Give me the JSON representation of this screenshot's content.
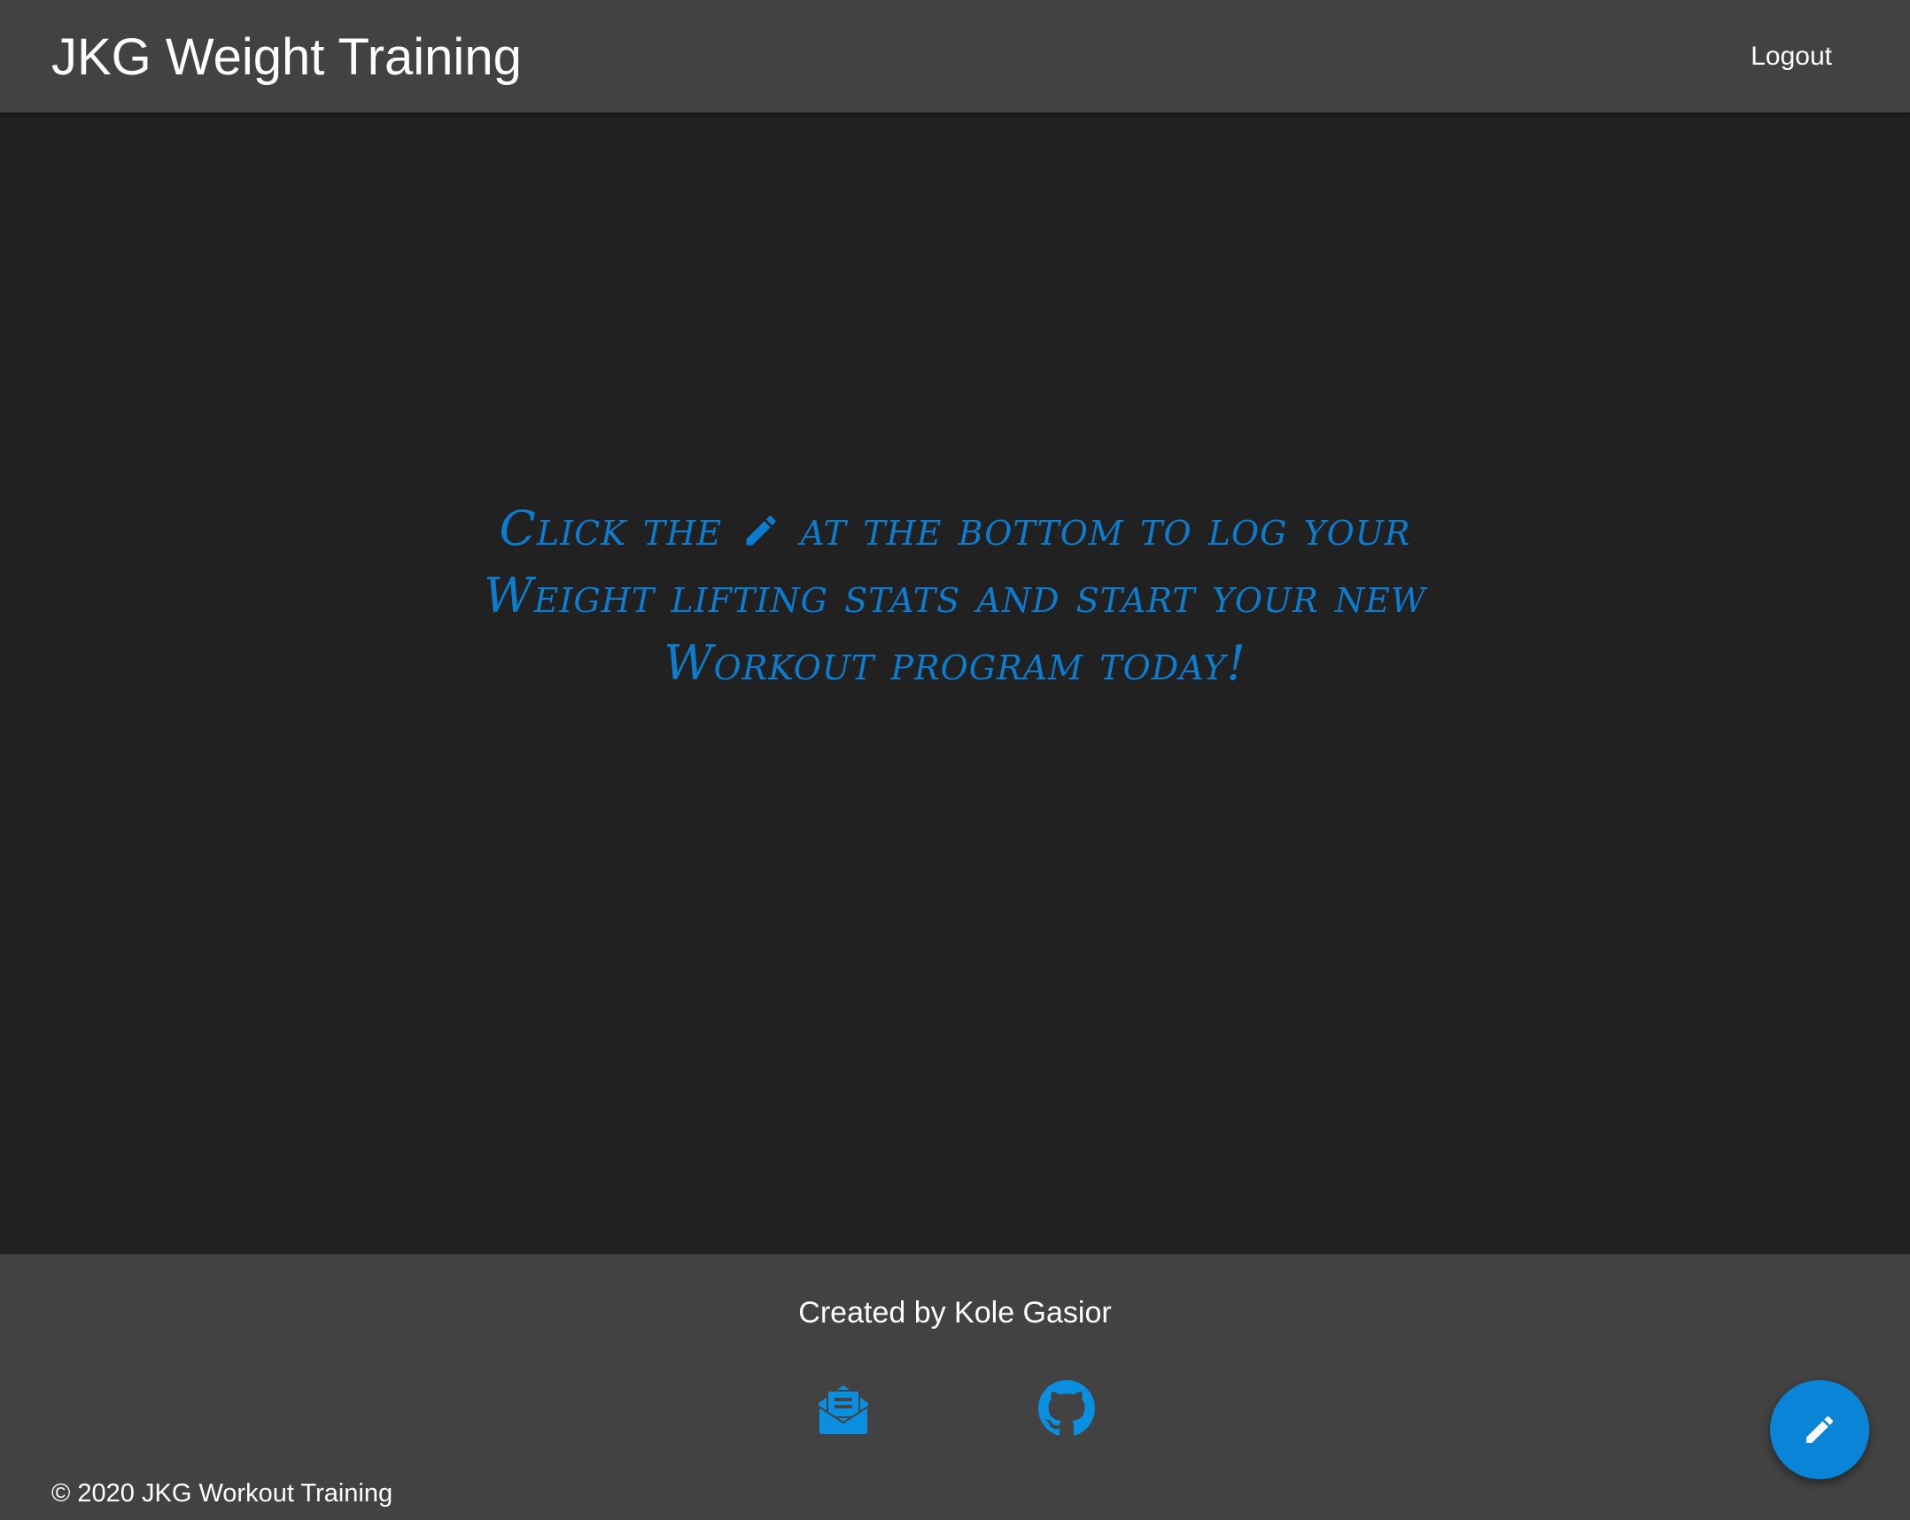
{
  "header": {
    "title": "JKG Weight Training",
    "logout_label": "Logout"
  },
  "hero": {
    "text_before_icon": "Click the",
    "icon": "pencil-icon",
    "text_after_icon": "at the bottom to log your Weight lifting stats and start your new Workout program today!"
  },
  "footer": {
    "created_by": "Created by Kole Gasior",
    "social_icons": [
      "mail-icon",
      "github-icon"
    ],
    "copyright": "© 2020 JKG Workout Training"
  },
  "fab": {
    "icon": "pencil-icon"
  },
  "colors": {
    "header_bg": "#424242",
    "main_bg": "#212121",
    "footer_bg": "#424242",
    "accent": "#0a84d6",
    "hero_text": "#0b7dd1"
  }
}
